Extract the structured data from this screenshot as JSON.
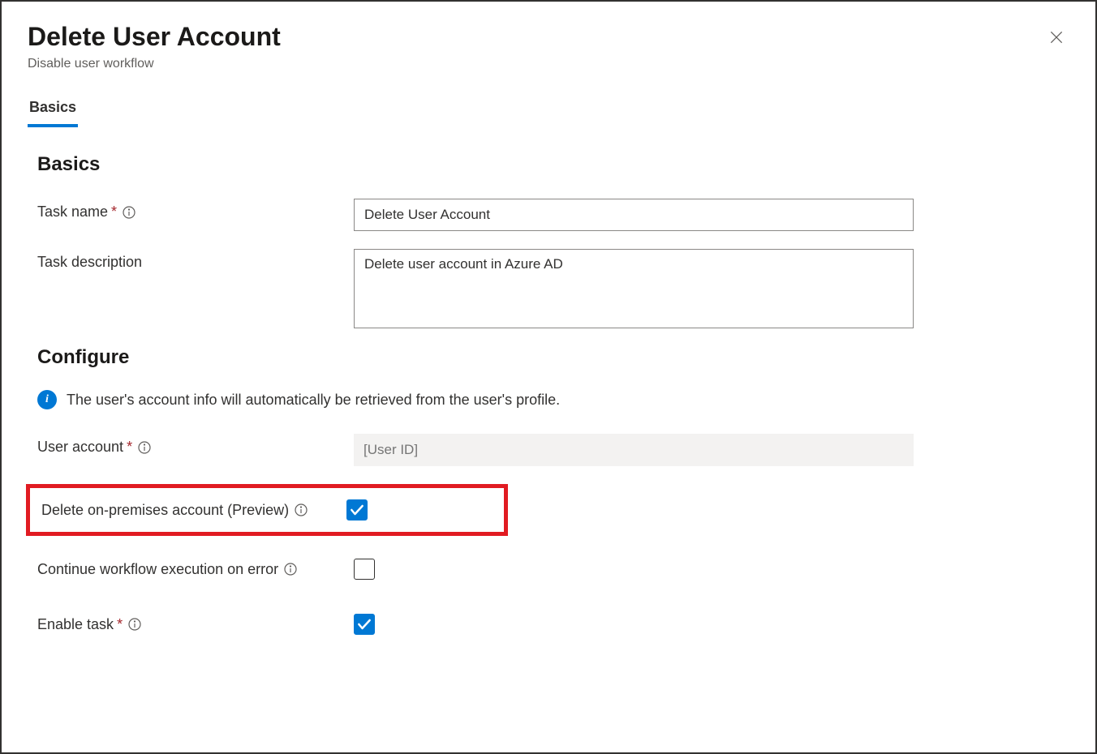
{
  "header": {
    "title": "Delete User Account",
    "subtitle": "Disable user workflow"
  },
  "tabs": {
    "basics": "Basics"
  },
  "sections": {
    "basics_title": "Basics",
    "configure_title": "Configure"
  },
  "fields": {
    "task_name": {
      "label": "Task name",
      "value": "Delete User Account",
      "required": true
    },
    "task_description": {
      "label": "Task description",
      "value": "Delete user account in Azure AD"
    },
    "user_account": {
      "label": "User account",
      "placeholder": "[User ID]",
      "required": true
    },
    "delete_on_premises": {
      "label": "Delete on-premises account (Preview)",
      "checked": true
    },
    "continue_on_error": {
      "label": "Continue workflow execution on error",
      "checked": false
    },
    "enable_task": {
      "label": "Enable task",
      "required": true,
      "checked": true
    }
  },
  "info_banner": "The user's account info will automatically be retrieved from the user's profile.",
  "required_marker": "*"
}
